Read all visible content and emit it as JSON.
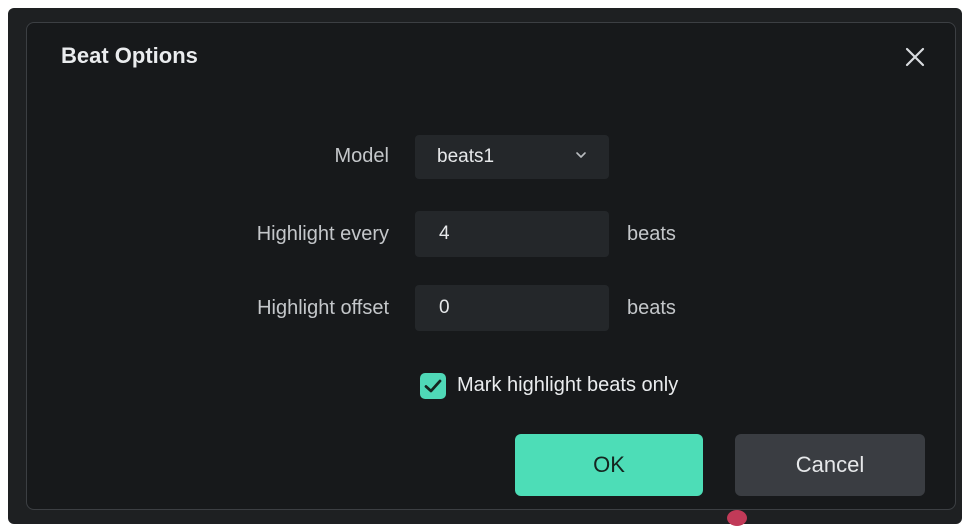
{
  "dialog": {
    "title": "Beat Options",
    "close_icon": "close-icon"
  },
  "form": {
    "model": {
      "label": "Model",
      "value": "beats1",
      "dropdown_icon": "chevron-down-icon"
    },
    "highlight_every": {
      "label": "Highlight every",
      "value": "4",
      "unit": "beats"
    },
    "highlight_offset": {
      "label": "Highlight offset",
      "value": "0",
      "unit": "beats"
    },
    "mark_highlight": {
      "label": "Mark highlight beats only",
      "checked": true,
      "icon": "checkmark-icon"
    }
  },
  "buttons": {
    "ok": "OK",
    "cancel": "Cancel"
  },
  "colors": {
    "accent": "#4dddb7",
    "dialog_bg": "#17191b",
    "field_bg": "#24272a",
    "cancel_bg": "#3a3d42"
  }
}
